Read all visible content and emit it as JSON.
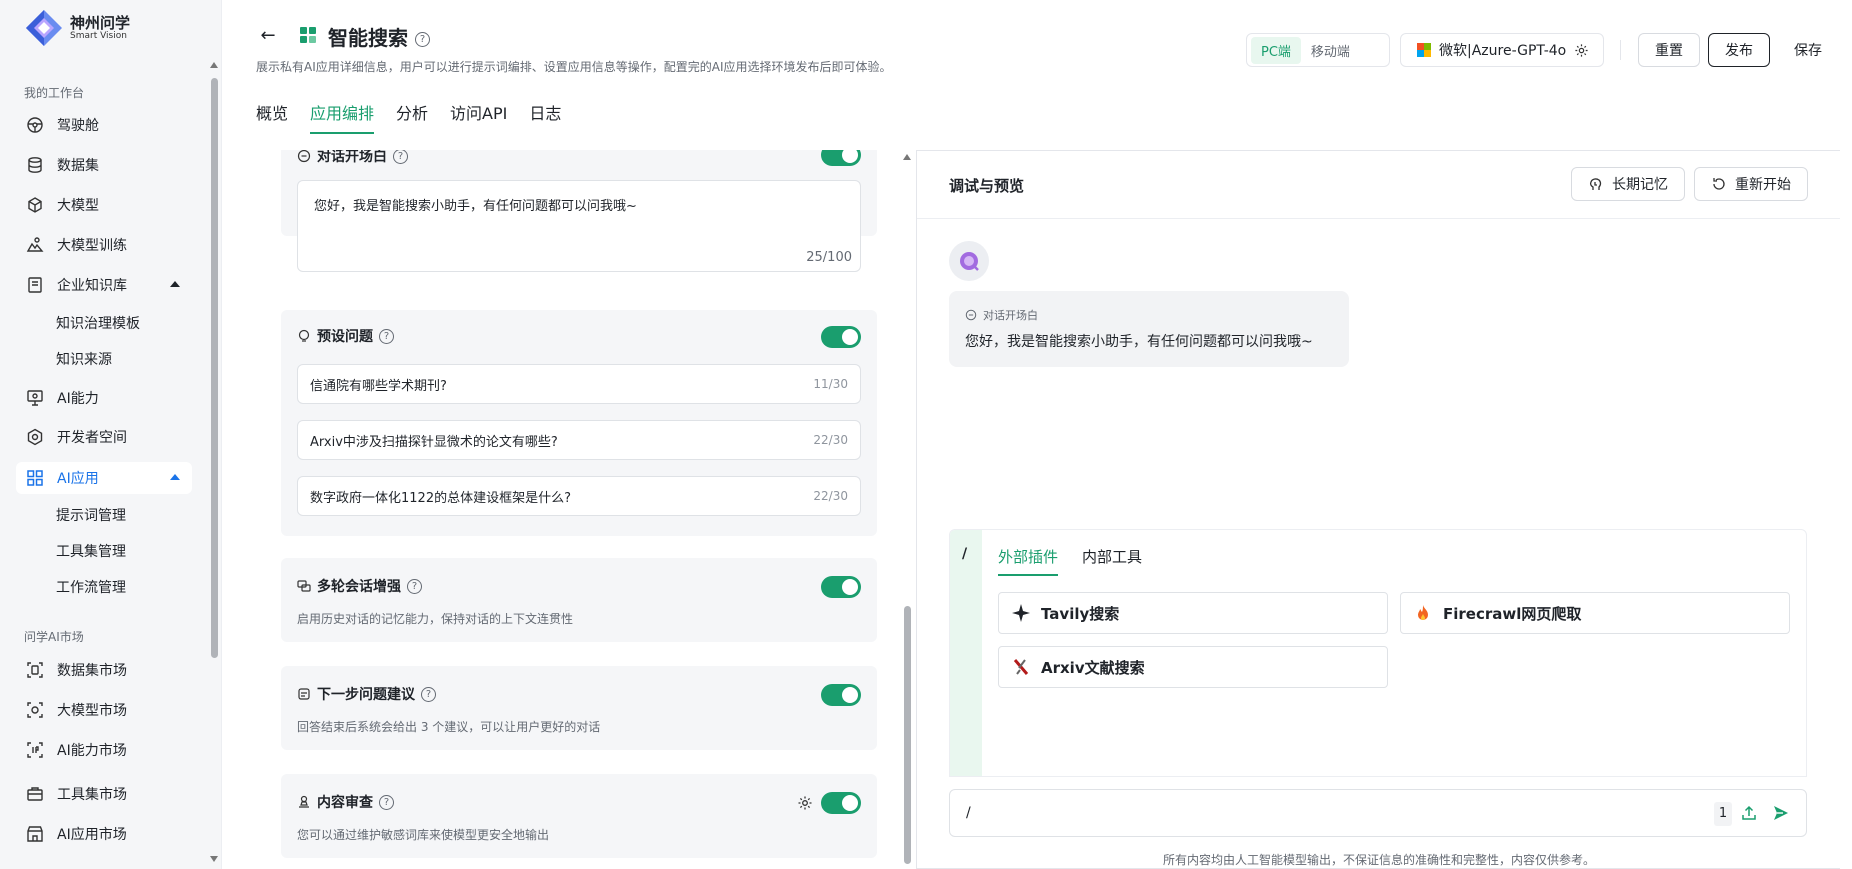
{
  "brand": {
    "name": "神州问学",
    "sub": "Smart Vision"
  },
  "sidebar": {
    "section_workspace": "我的工作台",
    "items": [
      {
        "label": "驾驶舱"
      },
      {
        "label": "数据集"
      },
      {
        "label": "大模型"
      },
      {
        "label": "大模型训练"
      },
      {
        "label": "企业知识库"
      },
      {
        "label": "AI能力"
      },
      {
        "label": "开发者空间"
      },
      {
        "label": "AI应用"
      }
    ],
    "kb_sub": [
      "知识治理模板",
      "知识来源"
    ],
    "app_sub": [
      "提示词管理",
      "工具集管理",
      "工作流管理"
    ],
    "section_market": "问学AI市场",
    "market": [
      {
        "label": "数据集市场"
      },
      {
        "label": "大模型市场"
      },
      {
        "label": "AI能力市场"
      },
      {
        "label": "工具集市场"
      },
      {
        "label": "AI应用市场"
      }
    ]
  },
  "header": {
    "title": "智能搜索",
    "description": "展示私有AI应用详细信息，用户可以进行提示词编排、设置应用信息等操作，配置完的AI应用选择环境发布后即可体验。",
    "tabs": [
      "概览",
      "应用编排",
      "分析",
      "访问API",
      "日志"
    ],
    "active_tab": "应用编排",
    "platform": [
      "PC端",
      "移动端"
    ],
    "model": "微软|Azure-GPT-4o",
    "reset": "重置",
    "publish": "发布",
    "save": "保存"
  },
  "config": {
    "opening": {
      "title": "对话开场白",
      "text": "您好，我是智能搜索小助手，有任何问题都可以问我哦~",
      "count": "25/100"
    },
    "preset": {
      "title": "预设问题",
      "questions": [
        {
          "text": "信通院有哪些学术期刊?",
          "count": "11/30"
        },
        {
          "text": "Arxiv中涉及扫描探针显微术的论文有哪些?",
          "count": "22/30"
        },
        {
          "text": "数字政府一体化1122的总体建设框架是什么?",
          "count": "22/30"
        }
      ]
    },
    "multiturn": {
      "title": "多轮会话增强",
      "desc": "启用历史对话的记忆能力，保持对话的上下文连贯性"
    },
    "next": {
      "title": "下一步问题建议",
      "desc": "回答结束后系统会给出 3 个建议，可以让用户更好的对话"
    },
    "review": {
      "title": "内容审查",
      "desc": "您可以通过维护敏感词库来使模型更安全地输出"
    }
  },
  "preview": {
    "title": "调试与预览",
    "memory_btn": "长期记忆",
    "restart_btn": "重新开始",
    "bubble_label": "对话开场白",
    "bubble_text": "您好，我是智能搜索小助手，有任何问题都可以问我哦~",
    "slash": "/",
    "plugin_tabs": [
      "外部插件",
      "内部工具"
    ],
    "plugins": [
      "Tavily搜索",
      "Firecrawl网页爬取",
      "Arxiv文献搜索"
    ],
    "input_value": "/",
    "input_count": "1",
    "footer": "所有内容均由人工智能模型输出，不保证信息的准确性和完整性，内容仅供参考。"
  },
  "colors": {
    "accent": "#1a9e6e",
    "nav_active": "#1a73e8"
  }
}
